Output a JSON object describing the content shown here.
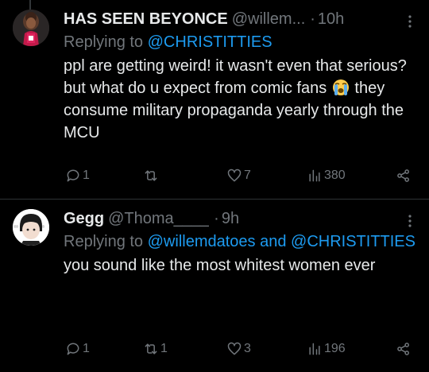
{
  "tweets": [
    {
      "author_name": "HAS SEEN BEYONCE",
      "handle": "@willem...",
      "dot": "·",
      "time": "10h",
      "replying_label": "Replying to",
      "replying_mentions": "@CHRISTITTIES",
      "text_before_emoji": "ppl are getting weird! it wasn't even that serious? but what do u expect from comic fans",
      "emoji": "loudly-crying-face",
      "text_after_emoji": "they consume military propaganda yearly through the MCU",
      "replies": "1",
      "retweets": "",
      "likes": "7",
      "views": "380"
    },
    {
      "author_name": "Gegg",
      "handle": "@Thoma____",
      "dot": "·",
      "time": "9h",
      "replying_label": "Replying to",
      "replying_mentions": "@willemdatoes and @CHRISTITTIES",
      "text": "you sound like the most whitest women ever",
      "replies": "1",
      "retweets": "1",
      "likes": "3",
      "views": "196"
    }
  ],
  "colors": {
    "background": "#000000",
    "text": "#e7e9ea",
    "muted": "#71767b",
    "mention": "#1d9bf0",
    "divider": "#2f3336"
  }
}
